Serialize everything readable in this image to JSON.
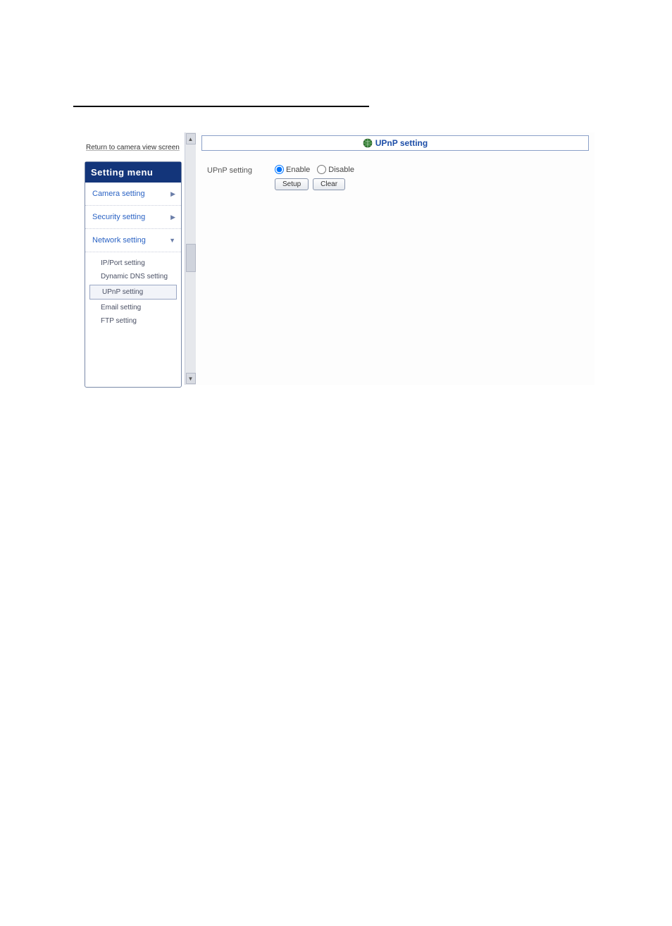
{
  "return_link": "Return to camera view screen",
  "menu": {
    "header": "Setting menu",
    "categories": [
      {
        "label": "Camera setting",
        "expanded": false
      },
      {
        "label": "Security setting",
        "expanded": false
      },
      {
        "label": "Network setting",
        "expanded": true
      }
    ],
    "sub_items": [
      {
        "label": "IP/Port setting",
        "selected": false
      },
      {
        "label": "Dynamic DNS setting",
        "selected": false
      },
      {
        "label": "UPnP setting",
        "selected": true
      },
      {
        "label": "Email setting",
        "selected": false
      },
      {
        "label": "FTP setting",
        "selected": false
      }
    ]
  },
  "panel": {
    "title": "UPnP setting",
    "field_label": "UPnP setting",
    "option_enable": "Enable",
    "option_disable": "Disable",
    "selected": "enable",
    "btn_setup": "Setup",
    "btn_clear": "Clear"
  }
}
